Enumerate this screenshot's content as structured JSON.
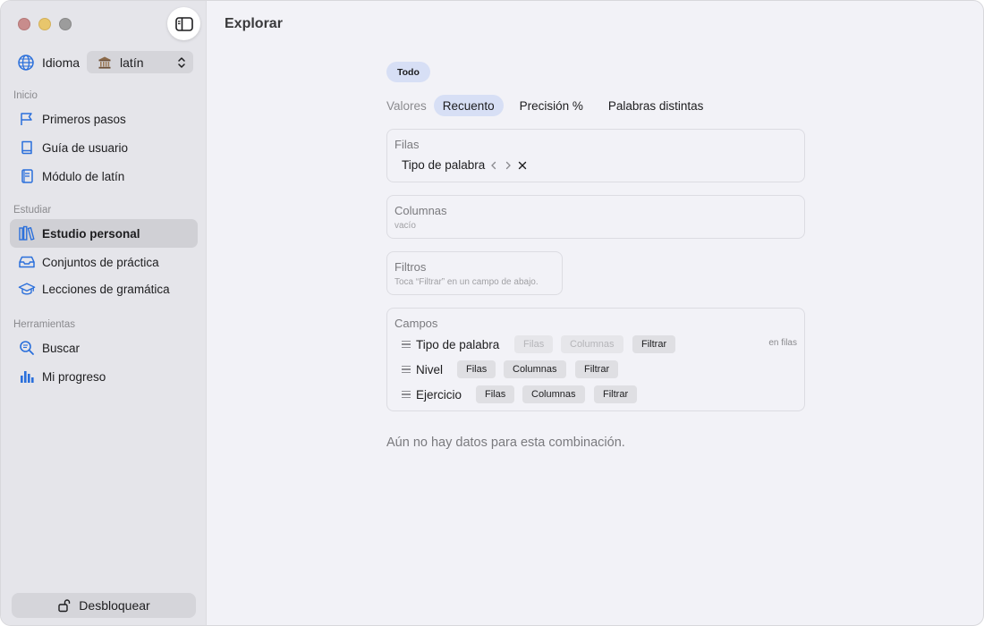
{
  "window": {
    "controls": [
      "close",
      "minimize",
      "maximize"
    ],
    "colors": {
      "close": "#c88c8c",
      "minimize": "#e8c66c",
      "maximize": "#9c9c9c"
    }
  },
  "sidebar": {
    "toggle_icon": "sidebar-toggle-icon",
    "language": {
      "label": "Idioma",
      "icon": "globe-icon",
      "selected": "latín",
      "flag_icon": "temple-icon"
    },
    "sections": [
      {
        "title": "Inicio",
        "items": [
          {
            "label": "Primeros pasos",
            "icon": "flag-icon"
          },
          {
            "label": "Guía de usuario",
            "icon": "book-icon"
          },
          {
            "label": "Módulo de latín",
            "icon": "module-book-icon"
          }
        ]
      },
      {
        "title": "Estudiar",
        "items": [
          {
            "label": "Estudio personal",
            "icon": "library-icon",
            "active": true
          },
          {
            "label": "Conjuntos de práctica",
            "icon": "tray-icon"
          },
          {
            "label": "Lecciones de gramática",
            "icon": "graduation-cap-icon"
          }
        ]
      },
      {
        "title": "Herramientas",
        "items": [
          {
            "label": "Buscar",
            "icon": "search-icon"
          },
          {
            "label": "Mi progreso",
            "icon": "bar-chart-icon"
          }
        ]
      }
    ],
    "unlock_label": "Desbloquear",
    "accent": "#2a6fdb"
  },
  "main": {
    "title": "Explorar",
    "scope_pill": "Todo",
    "values": {
      "label": "Valores",
      "tabs": [
        {
          "label": "Recuento",
          "active": true
        },
        {
          "label": "Precisión %",
          "active": false
        },
        {
          "label": "Palabras distintas",
          "active": false
        }
      ]
    },
    "rows_panel": {
      "title": "Filas",
      "chip": "Tipo de palabra"
    },
    "columns_panel": {
      "title": "Columnas",
      "empty": "vacío"
    },
    "filters_panel": {
      "title": "Filtros",
      "hint": "Toca “Filtrar” en un campo de abajo."
    },
    "fields_panel": {
      "title": "Campos",
      "fields": [
        {
          "name": "Tipo de palabra",
          "buttons": [
            "Filas",
            "Columnas",
            "Filtrar"
          ],
          "note": "en filas"
        },
        {
          "name": "Nivel",
          "buttons": [
            "Filas",
            "Columnas",
            "Filtrar"
          ]
        },
        {
          "name": "Ejercicio",
          "buttons": [
            "Filas",
            "Columnas",
            "Filtrar"
          ]
        }
      ]
    },
    "empty_message": "Aún no hay datos para esta combinación."
  }
}
